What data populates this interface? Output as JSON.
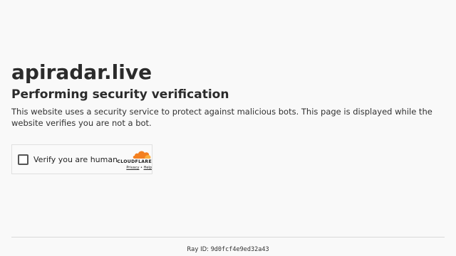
{
  "page": {
    "site_name": "apiradar.live",
    "heading": "Performing security verification",
    "description": "This website uses a security service to protect against malicious bots. This page is displayed while the website verifies you are not a bot."
  },
  "widget": {
    "checkbox_label": "Verify you are human",
    "brand": "CLOUDFLARE",
    "privacy_label": "Privacy",
    "separator": "•",
    "help_label": "Help",
    "brand_color": "#f38020"
  },
  "footer": {
    "ray_label": "Ray ID:",
    "ray_id": "9d0fcf4e9ed32a43"
  }
}
